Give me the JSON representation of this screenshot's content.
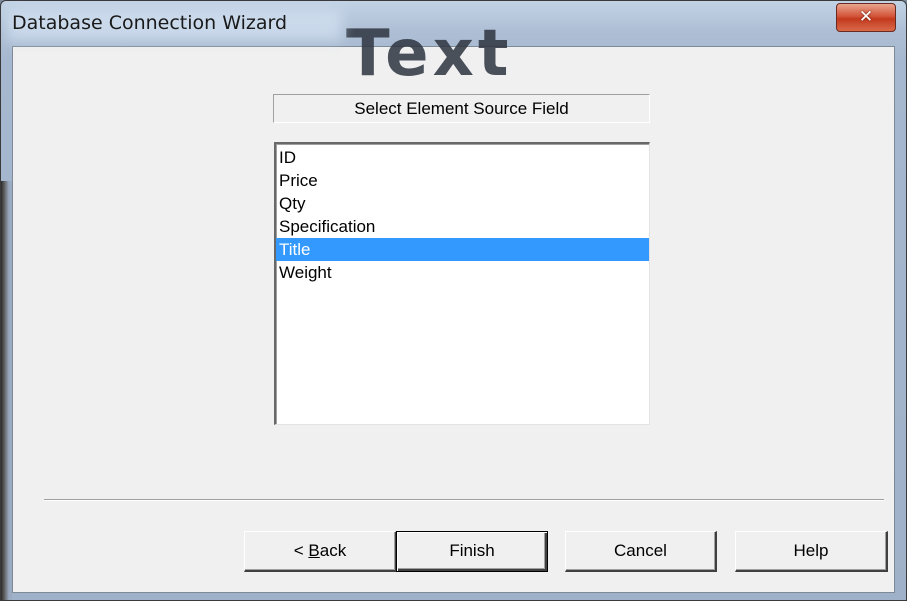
{
  "window": {
    "title": "Database Connection Wizard",
    "background_glyph": "Text",
    "close_glyph": "✕",
    "close_icon": "close-icon"
  },
  "header": {
    "label": "Select Element Source Field"
  },
  "list": {
    "items": [
      {
        "label": "ID",
        "selected": false
      },
      {
        "label": "Price",
        "selected": false
      },
      {
        "label": "Qty",
        "selected": false
      },
      {
        "label": "Specification",
        "selected": false
      },
      {
        "label": "Title",
        "selected": true
      },
      {
        "label": "Weight",
        "selected": false
      }
    ],
    "selected_color": "#3399ff"
  },
  "buttons": {
    "back_prefix": "< ",
    "back_mnemonic": "B",
    "back_rest": "ack",
    "finish": "Finish",
    "cancel": "Cancel",
    "help": "Help"
  },
  "colors": {
    "dialog_bg": "#f0f0f0",
    "close_button": "#c33a1e"
  }
}
